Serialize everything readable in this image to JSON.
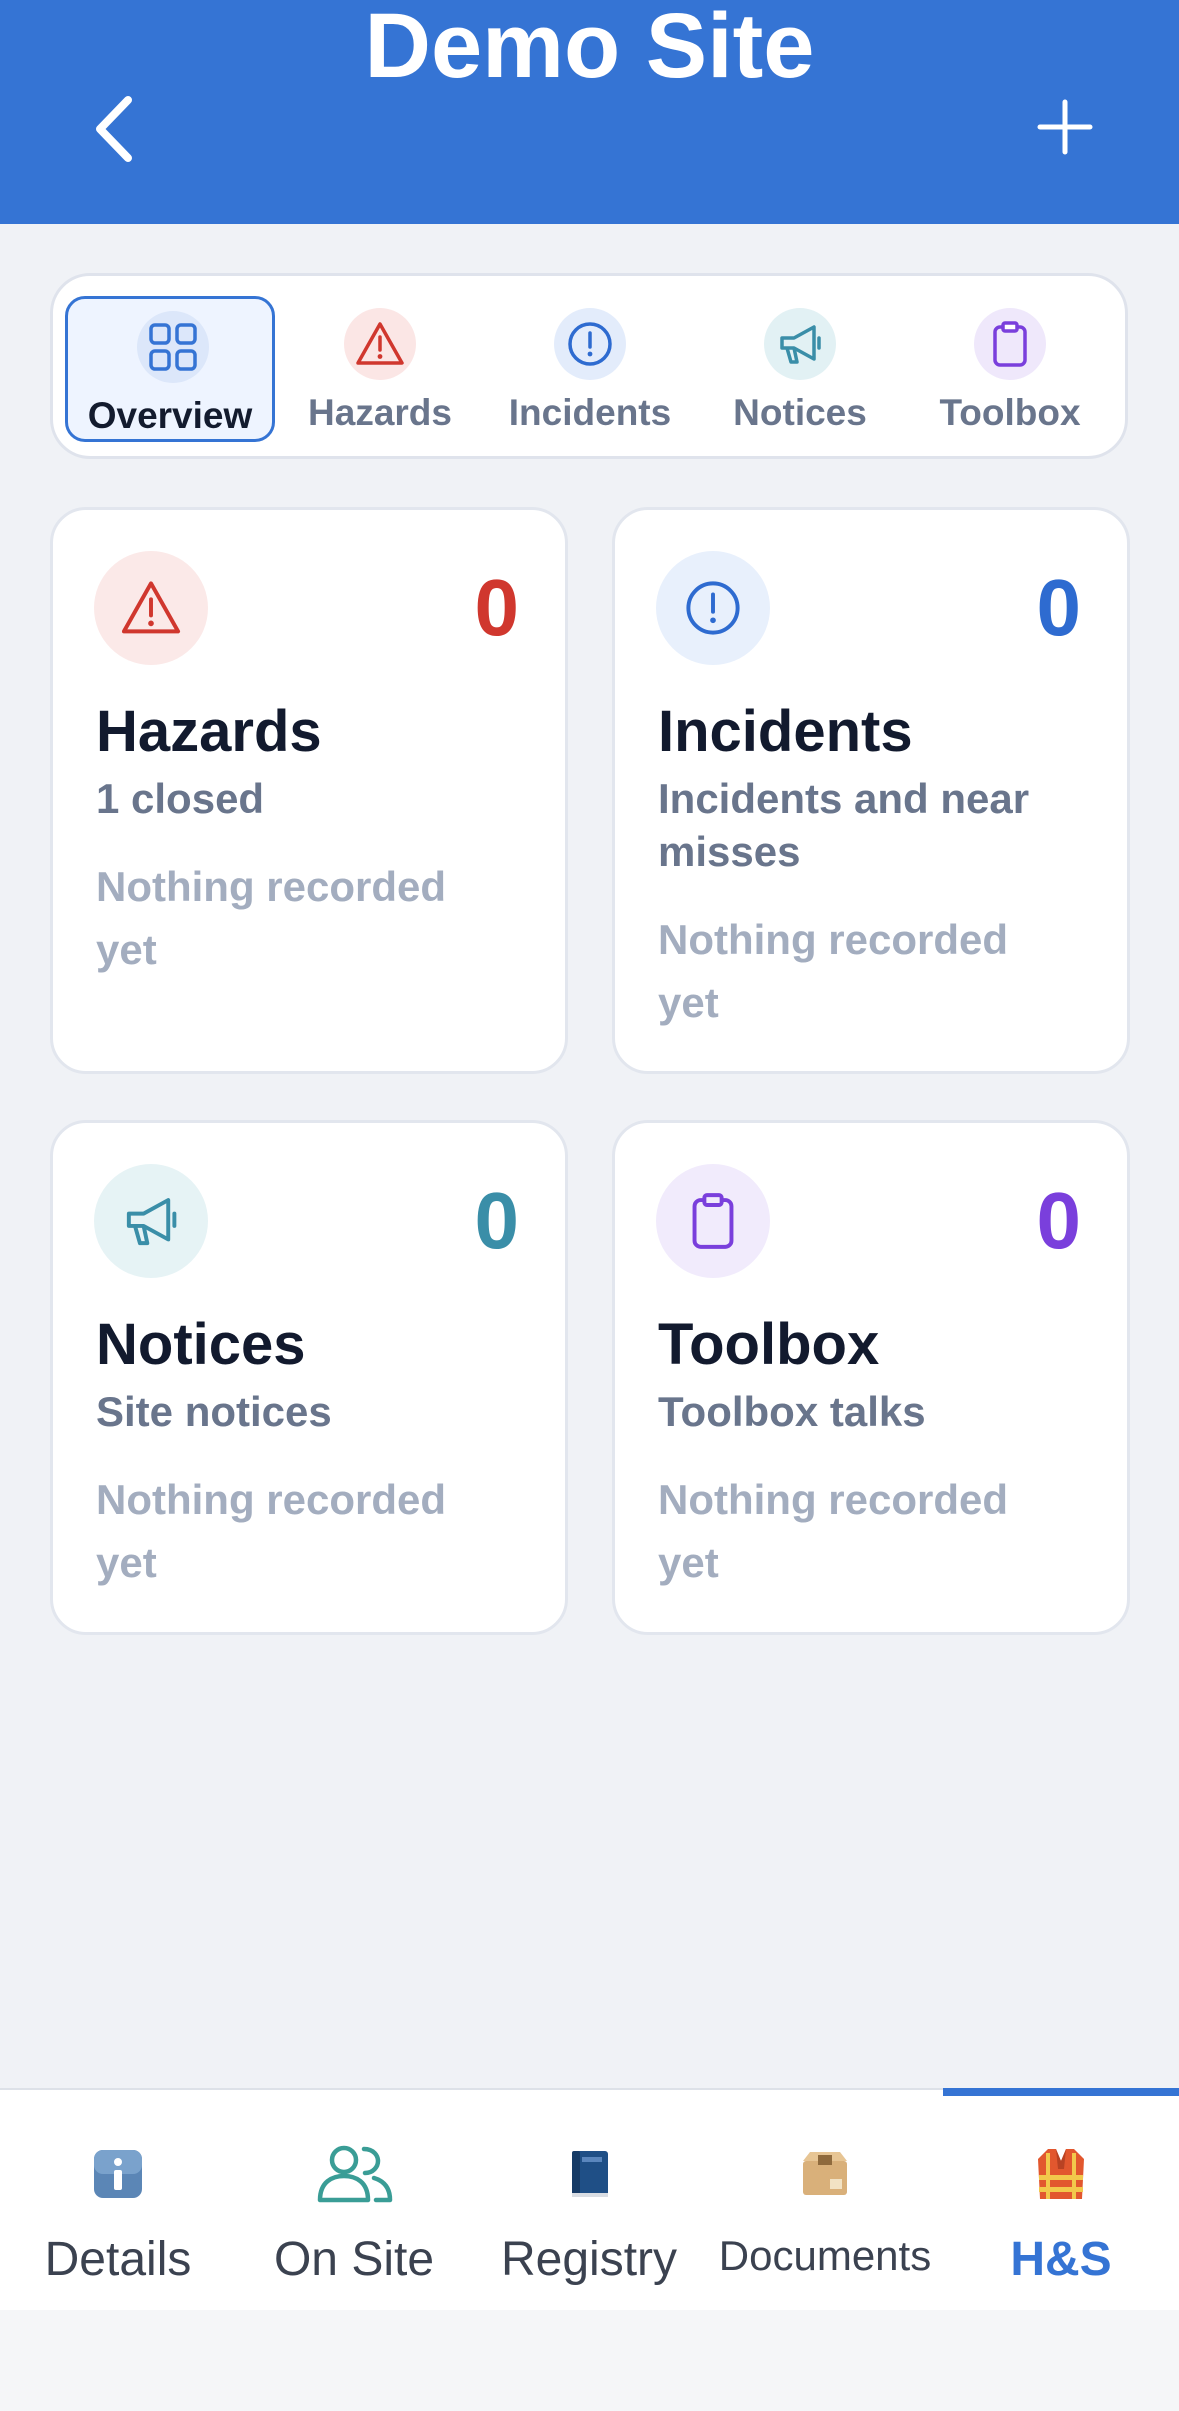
{
  "header": {
    "title": "Demo Site",
    "back_icon": "chevron-left-icon",
    "add_icon": "plus-icon"
  },
  "tabs": [
    {
      "label": "Overview",
      "icon": "grid-icon",
      "active": true
    },
    {
      "label": "Hazards",
      "icon": "warning-triangle-icon"
    },
    {
      "label": "Incidents",
      "icon": "exclamation-circle-icon"
    },
    {
      "label": "Notices",
      "icon": "megaphone-icon"
    },
    {
      "label": "Toolbox",
      "icon": "clipboard-icon"
    }
  ],
  "cards": [
    {
      "title": "Hazards",
      "count": "0",
      "subtitle": "1 closed",
      "empty": "Nothing recorded yet",
      "color": "#d0372e",
      "icon_bg": "#fbe9e8"
    },
    {
      "title": "Incidents",
      "count": "0",
      "subtitle": "Incidents and near misses",
      "empty": "Nothing recorded yet",
      "color": "#2e6bd0",
      "icon_bg": "#e8f0fc"
    },
    {
      "title": "Notices",
      "count": "0",
      "subtitle": "Site notices",
      "empty": "Nothing recorded yet",
      "color": "#3a8ea8",
      "icon_bg": "#e6f3f5"
    },
    {
      "title": "Toolbox",
      "count": "0",
      "subtitle": "Toolbox talks",
      "empty": "Nothing recorded yet",
      "color": "#7a3fdc",
      "icon_bg": "#f1ebfc"
    }
  ],
  "bottom_nav": [
    {
      "label": "Details",
      "icon": "info-icon"
    },
    {
      "label": "On Site",
      "icon": "people-icon"
    },
    {
      "label": "Registry",
      "icon": "book-icon"
    },
    {
      "label": "Documents",
      "icon": "box-icon"
    },
    {
      "label": "H&S",
      "icon": "safety-vest-icon",
      "active": true
    }
  ],
  "colors": {
    "accent": "#3574d4",
    "background": "#f0f2f6"
  }
}
